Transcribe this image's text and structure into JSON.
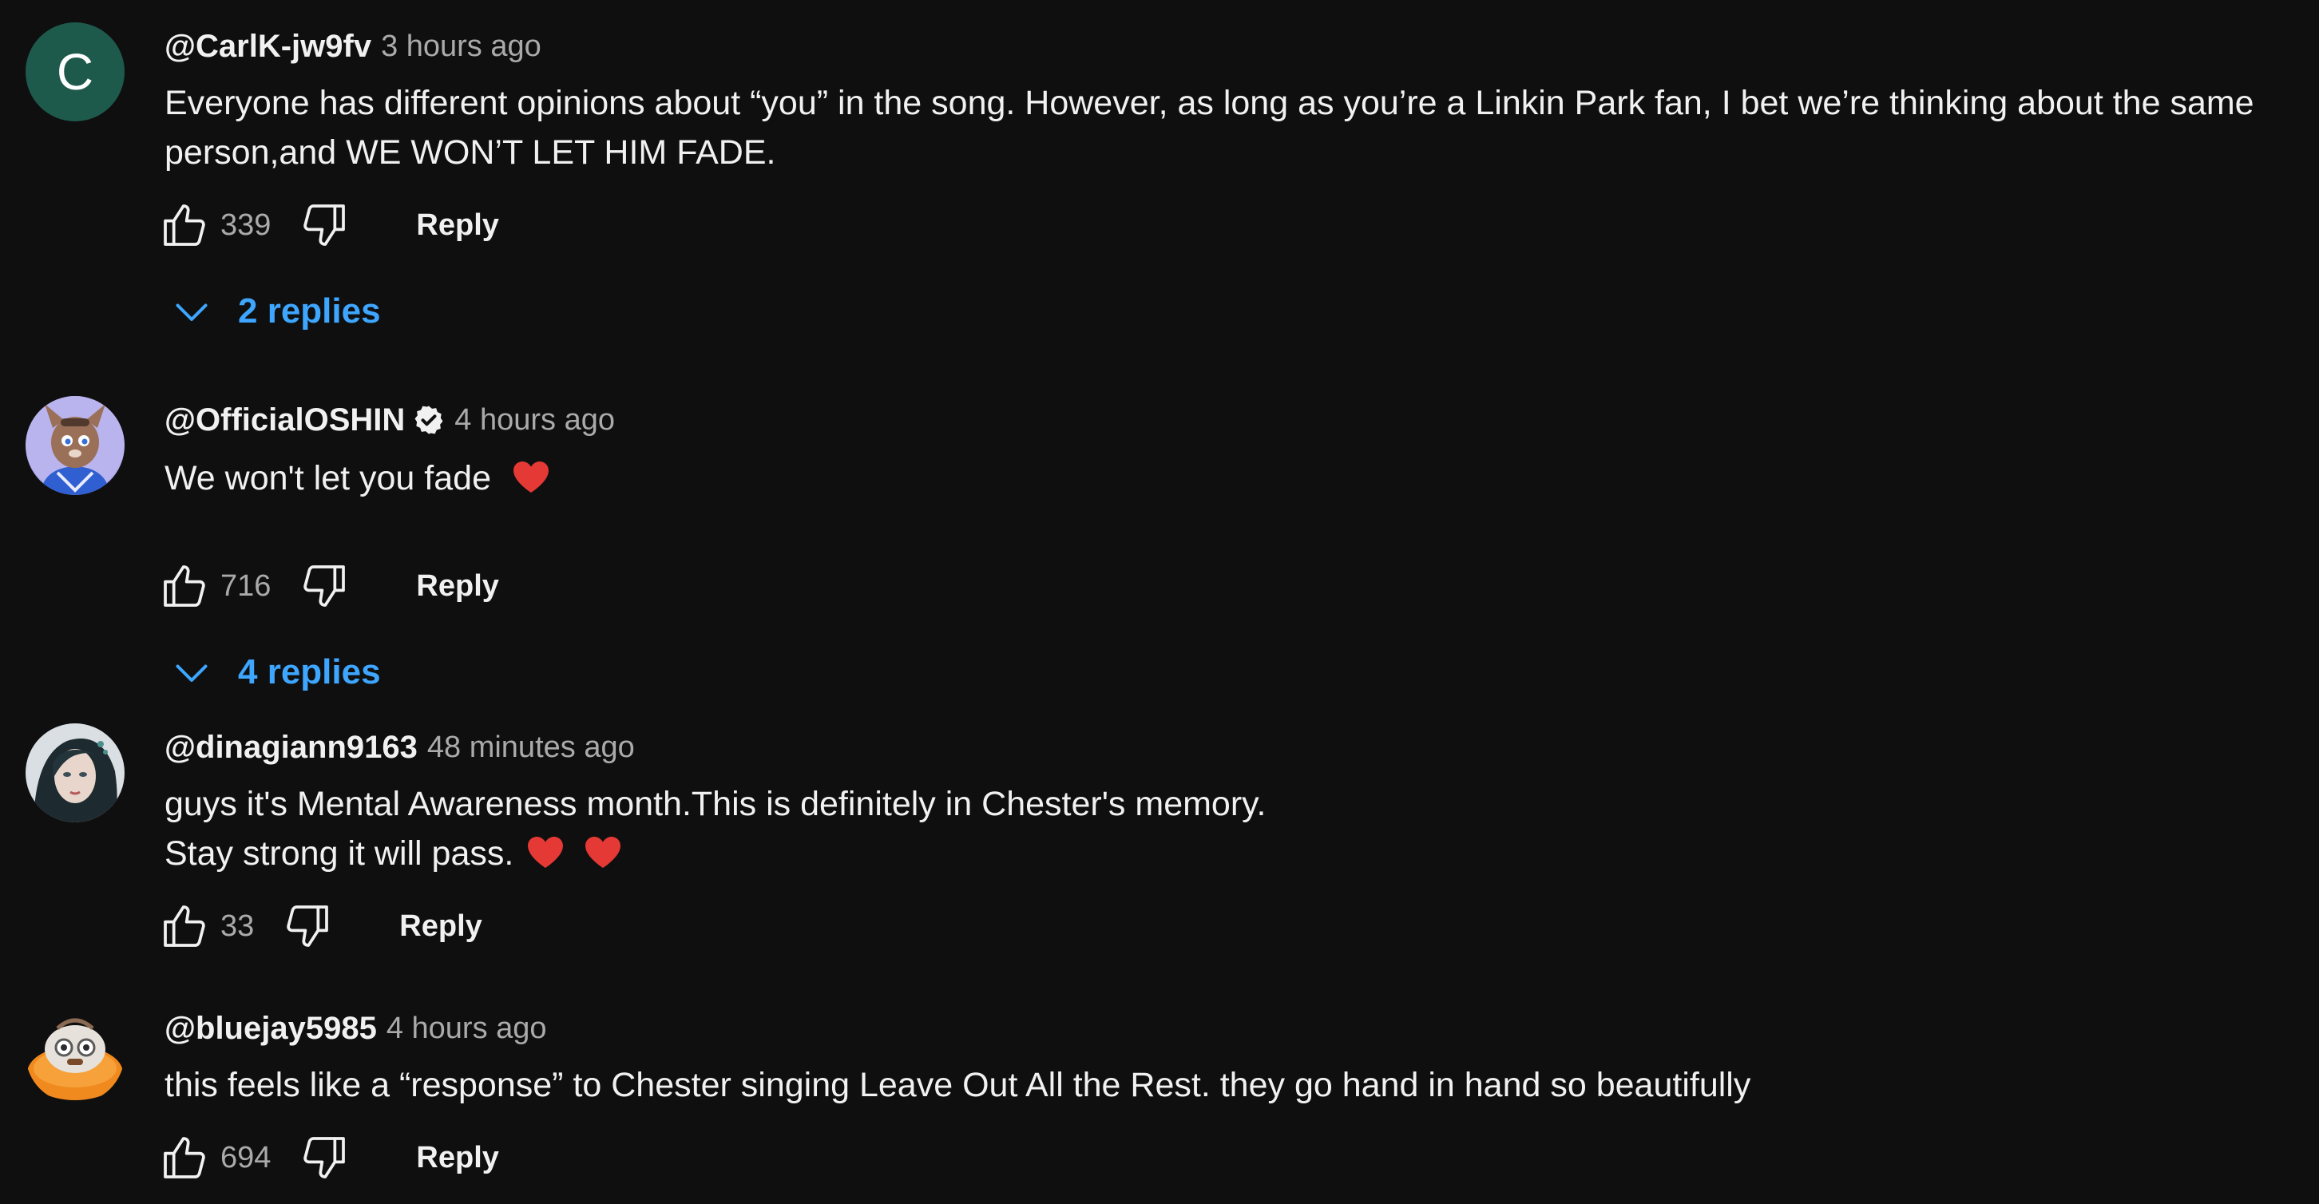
{
  "comments": [
    {
      "author": "@CarlK-jw9fv",
      "avatar_letter": "C",
      "time": "3 hours ago",
      "lines": [
        "Everyone has different opinions about “you” in the song. However, as long as you’re a Linkin Park fan, I bet we’re thinking about the same",
        "person,and WE WON’T LET HIM FADE."
      ],
      "likes": "339",
      "reply_label": "Reply",
      "replies_label": "2 replies"
    },
    {
      "author": "@OfficialOSHIN",
      "verified": true,
      "time": "4 hours ago",
      "lines": [
        "We won't let you fade"
      ],
      "likes": "716",
      "reply_label": "Reply",
      "replies_label": "4 replies"
    },
    {
      "author": "@dinagiann9163",
      "time": "48 minutes ago",
      "lines": [
        "guys it's Mental Awareness month.This is definitely in Chester's memory.",
        "Stay strong it will pass."
      ],
      "likes": "33",
      "reply_label": "Reply"
    },
    {
      "author": "@bluejay5985",
      "time": "4 hours ago",
      "lines": [
        "this feels like a “response” to Chester singing Leave Out All the Rest. they go hand in hand so beautifully"
      ],
      "likes": "694",
      "reply_label": "Reply"
    }
  ],
  "icons": {
    "like": "thumbs-up-icon",
    "dislike": "thumbs-down-icon",
    "expand": "chevron-down-icon",
    "verified": "verified-badge-icon",
    "heart": "red-heart-emoji"
  },
  "colors": {
    "background": "#0f0f0f",
    "text": "#f1f1f1",
    "secondary_text": "#aaaaaa",
    "link": "#3ea6ff",
    "heart": "#e53935",
    "avatar_c": "#1e5a4c"
  }
}
